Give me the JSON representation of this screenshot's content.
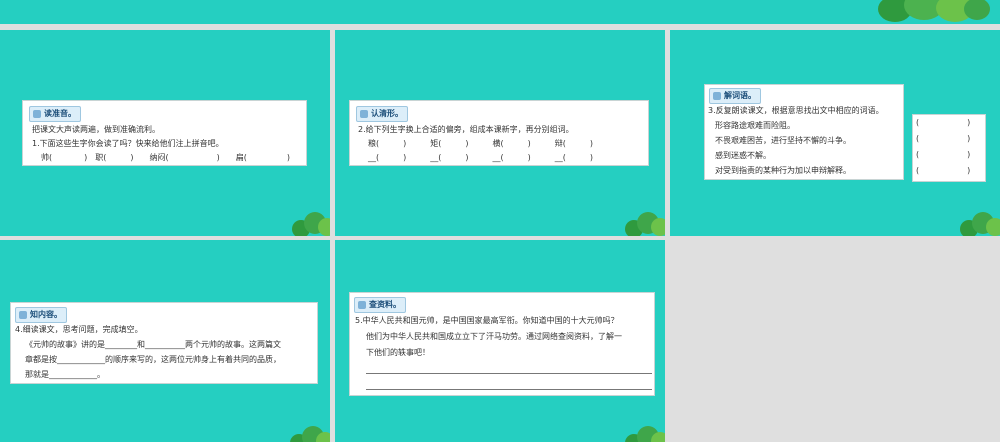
{
  "slide1": {
    "badge": "读准音。",
    "lines": [
      "把课文大声读两遍，做到准确流利。",
      "1.下面这些生字你会读了吗？快来给他们注上拼音吧。",
      "帅(　　　　)　职(　　　)　　纳闷(　　　　　　)　　扁(　　　　　)"
    ]
  },
  "slide2": {
    "badge": "认清形。",
    "lines": [
      "2.给下列生字换上合适的偏旁，组成本课新字，再分别组词。",
      "粮(　　　)　　　矩(　　　)　　　横(　　　)　　　辩(　　　)",
      "__(　　　)　　　__(　　　)　　　__(　　　)　　　__(　　　)"
    ]
  },
  "slide3": {
    "badge": "解词语。",
    "lines": [
      "3.反复朗读课文，根据意思找出文中相应的词语。",
      "形容路途艰难而险阻。",
      "不畏艰难困苦，进行坚持不懈的斗争。",
      "感到迷惑不解。",
      "对受到指责的某种行为加以申辩解释。"
    ],
    "answers": [
      "(　　　　　　)",
      "(　　　　　　)",
      "(　　　　　　)",
      "(　　　　　　)"
    ]
  },
  "slide4": {
    "badge": "知内容。",
    "lines": [
      "4.细读课文，思考问题，完成填空。",
      "《元帅的故事》讲的是________和__________两个元帅的故事。这两篇文",
      "章都是按____________的顺序来写的，这两位元帅身上有着共同的品质，",
      "那就是____________。"
    ]
  },
  "slide5": {
    "badge": "查资料。",
    "lines": [
      "5.中华人民共和国元帅，是中国国家最高军衔。你知道中国的十大元帅吗？",
      "他们为中华人民共和国成立立下了汗马功劳。通过网络查阅资料，了解一",
      "下他们的轶事吧！"
    ]
  },
  "colors": {
    "slide_bg": "#25cfc1",
    "page_bg": "#dfdfdf",
    "tree": "#3fa64a"
  }
}
